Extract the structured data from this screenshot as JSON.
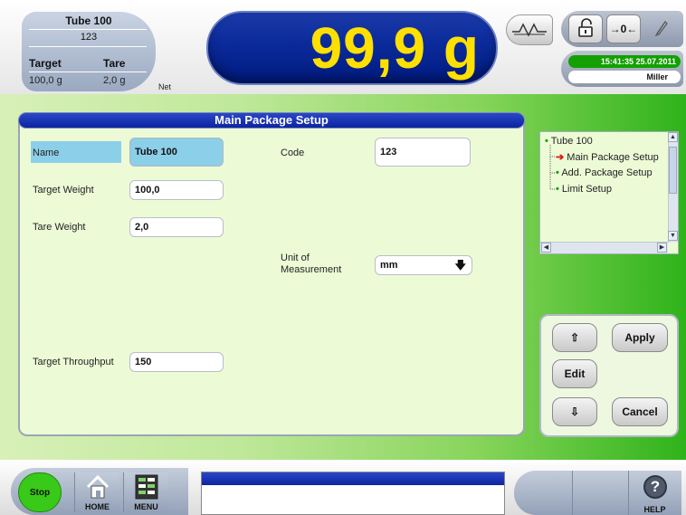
{
  "header": {
    "product_name": "Tube 100",
    "product_code": "123",
    "target_label": "Target",
    "tare_label": "Tare",
    "target_value": "100,0 g",
    "tare_value": "2,0 g",
    "net_label": "Net",
    "weight": "99,9 g",
    "zero_label": "→0←",
    "clock": "15:41:35  25.07.2011",
    "user": "Miller"
  },
  "form": {
    "title": "Main Package Setup",
    "name_label": "Name",
    "name_value": "Tube 100",
    "code_label": "Code",
    "code_value": "123",
    "target_weight_label": "Target Weight",
    "target_weight_value": "100,0",
    "tare_weight_label": "Tare Weight",
    "tare_weight_value": "2,0",
    "unit_label_line1": "Unit of",
    "unit_label_line2": "Measurement",
    "unit_value": "mm",
    "target_throughput_label": "Target Throughput",
    "target_throughput_value": "150"
  },
  "tree": {
    "root": "Tube 100",
    "items": [
      "Main Package Setup",
      "Add. Package Setup",
      "Limit Setup"
    ],
    "selected": "Main Package Setup"
  },
  "nav": {
    "up_label": "⇧",
    "down_label": "⇩",
    "apply_label": "Apply",
    "edit_label": "Edit",
    "cancel_label": "Cancel"
  },
  "footer": {
    "stop_label": "Stop",
    "home_label": "HOME",
    "menu_label": "MENU",
    "help_label": "HELP",
    "help_symbol": "?"
  },
  "colors": {
    "weight_text": "#ffe000",
    "weight_bg": "#0b2a9a",
    "title_bar": "#1a35b8",
    "stop_green": "#39c918",
    "clock_green": "#13a000",
    "field_highlight": "#8ccfe8"
  },
  "icons": {
    "wave": "wave-icon",
    "lock": "unlock-icon",
    "tool": "pencil-icon",
    "home": "home-icon",
    "menu": "menu-icon",
    "help": "help-icon"
  }
}
